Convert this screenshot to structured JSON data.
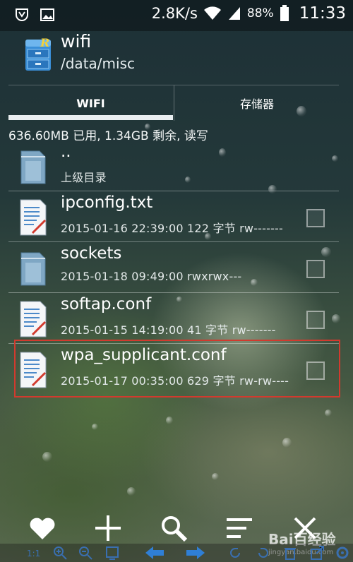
{
  "status": {
    "speed": "2.8K/s",
    "battery": "88%",
    "time": "11:33"
  },
  "header": {
    "title": "wifi",
    "path": "/data/misc"
  },
  "tabs": [
    {
      "label": "WIFI",
      "active": true
    },
    {
      "label": "存储器",
      "active": false
    }
  ],
  "usage": "636.60MB 已用, 1.34GB 剩余, 读写",
  "files": [
    {
      "name": "..",
      "meta": "上级目录",
      "type": "folder",
      "checkbox": false
    },
    {
      "name": "ipconfig.txt",
      "meta": "2015-01-16 22:39:00  122 字节  rw-------",
      "type": "file",
      "checkbox": true
    },
    {
      "name": "sockets",
      "meta": "2015-01-18 09:49:00   rwxrwx---",
      "type": "folder",
      "checkbox": true
    },
    {
      "name": "softap.conf",
      "meta": "2015-01-15 14:19:00  41 字节  rw-------",
      "type": "file",
      "checkbox": true
    },
    {
      "name": "wpa_supplicant.conf",
      "meta": "2015-01-17 00:35:00  629 字节  rw-rw----",
      "type": "file",
      "checkbox": true
    }
  ],
  "toolbar_icons": [
    "heart-icon",
    "plus-icon",
    "search-icon",
    "menu-icon",
    "close-icon"
  ],
  "watermark": {
    "brand": "Bai百经验",
    "url": "jingyan.baidu.com"
  },
  "colors": {
    "highlight": "#d23a2e",
    "accent_blue": "#2f7fd6"
  }
}
